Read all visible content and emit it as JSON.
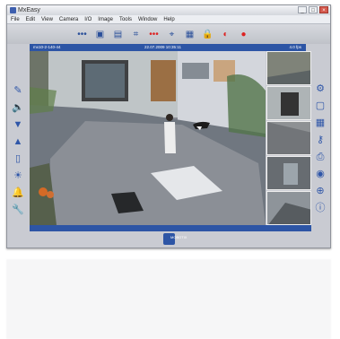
{
  "window": {
    "title": "MxEasy"
  },
  "menu": {
    "items": [
      "File",
      "Edit",
      "View",
      "Camera",
      "I/O",
      "Image",
      "Tools",
      "Window",
      "Help"
    ]
  },
  "toolbar": {
    "icons": [
      "dots",
      "layout-camera",
      "layout-wide",
      "layout-split",
      "recording-dots",
      "camera-board",
      "capture",
      "lock",
      "color",
      "alarm"
    ]
  },
  "viewbar": {
    "left_text": "mx10-2-140-44",
    "center_text": "22.07.2009 10:35:11",
    "right_text": "4.0 fps"
  },
  "logo": {
    "text": "MOBOTIX"
  }
}
